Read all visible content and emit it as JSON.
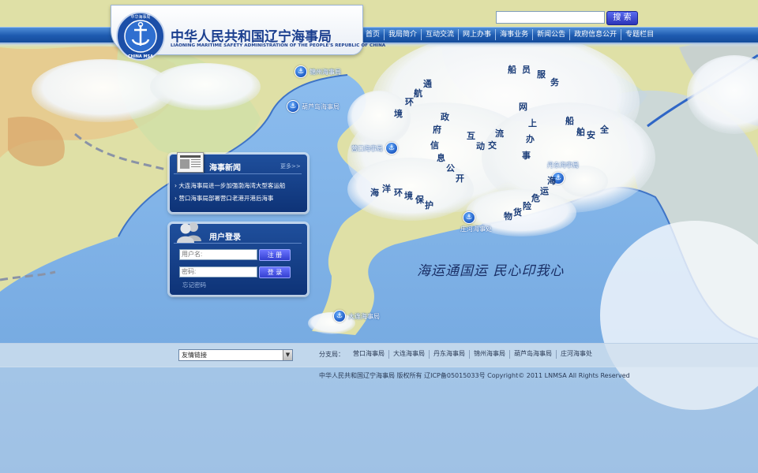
{
  "search": {
    "placeholder": "",
    "button_label": "搜 索"
  },
  "header": {
    "title": "中华人民共和国辽宁海事局",
    "subtitle": "LIAONING MARITIME SAFETY ADMINISTRATION OF THE PEOPLE'S REPUBLIC OF CHINA",
    "logo_ring_text": "中华海事局",
    "logo_bottom_text": "CHINA MSA"
  },
  "nav": {
    "items": [
      "首页",
      "我局简介",
      "互动交流",
      "网上办事",
      "海事业务",
      "新闻公告",
      "政府信息公开",
      "专题栏目"
    ]
  },
  "map": {
    "ports": [
      {
        "label": "锦州海事局"
      },
      {
        "label": "葫芦岛海事局"
      },
      {
        "label": "营口海事局"
      },
      {
        "label": "丹东海事局"
      },
      {
        "label": "庄河海事处"
      },
      {
        "label": "大连海事局"
      }
    ],
    "cloud_words": [
      "船",
      "员",
      "服",
      "务",
      "网",
      "上",
      "办",
      "事",
      "互",
      "动",
      "交",
      "流",
      "政",
      "府",
      "信",
      "息",
      "公",
      "开",
      "船",
      "舶",
      "安",
      "全",
      "通",
      "航",
      "环",
      "境",
      "海",
      "洋",
      "环",
      "境",
      "保",
      "护",
      "海",
      "运",
      "危",
      "险",
      "货",
      "物"
    ],
    "slogan": "海运通国运  民心印我心",
    "colors": {
      "sea": "#7fb1e6",
      "land": "#d9dba0",
      "coast": "#2e64c8"
    }
  },
  "news": {
    "title": "海事新闻",
    "more_label": "更多>>",
    "items": [
      "大连海事局进一步加强渤海湾大型客运船",
      "营口海事局部署营口老港开港后海事"
    ]
  },
  "login": {
    "title": "用户登录",
    "username_placeholder": "用户名:",
    "password_placeholder": "密码:",
    "register_label": "注 册",
    "login_label": "登 录",
    "forgot_label": "忘记密码"
  },
  "footer": {
    "links_select": "友情链接",
    "branches_label": "分支局：",
    "branches": [
      "营口海事局",
      "大连海事局",
      "丹东海事局",
      "锦州海事局",
      "葫芦岛海事局",
      "庄河海事处"
    ],
    "copyright": "中华人民共和国辽宁海事局  版权所有  辽ICP备05015033号  Copyright© 2011 LNMSA All Rights Reserved"
  }
}
